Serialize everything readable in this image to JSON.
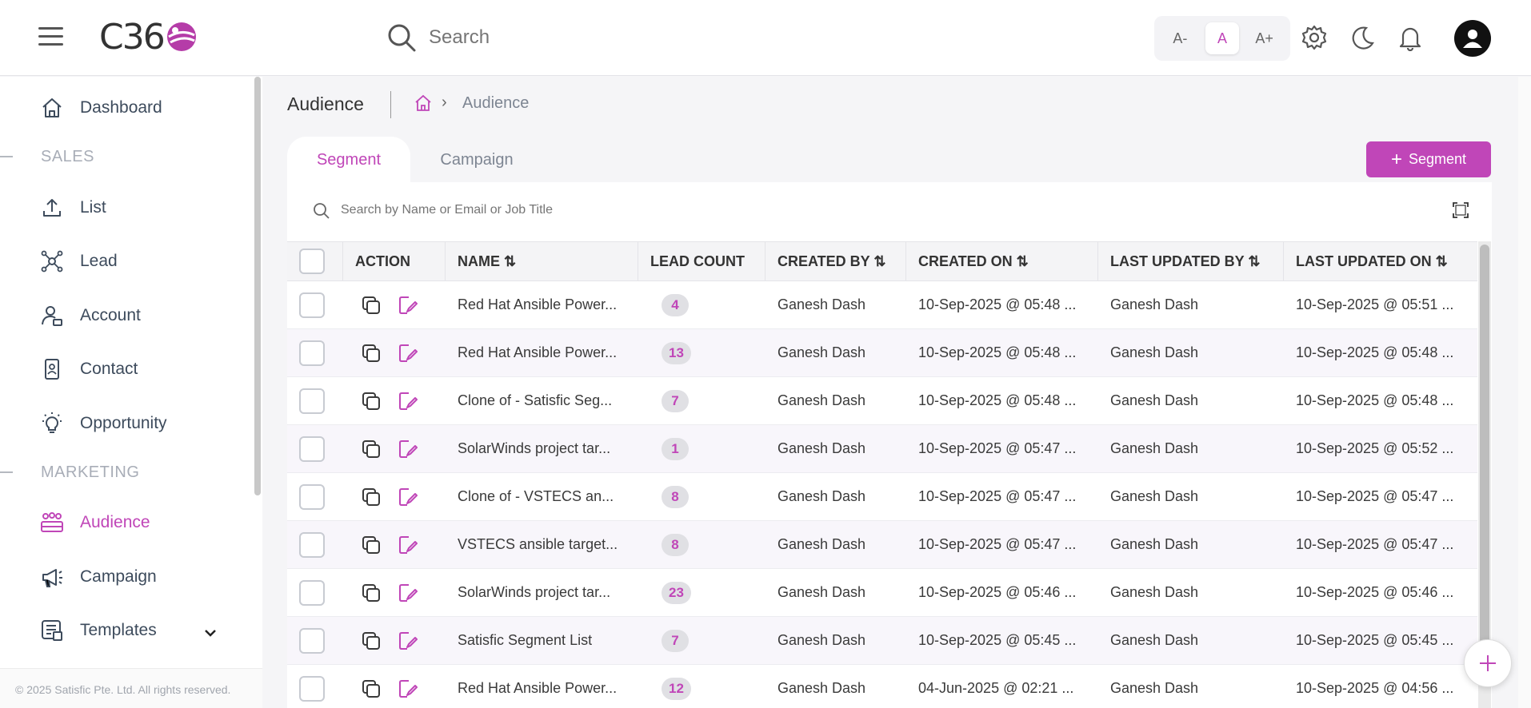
{
  "header": {
    "logo_text": "C36",
    "search_placeholder": "Search",
    "font_small": "A-",
    "font_normal": "A",
    "font_large": "A+"
  },
  "sidebar": {
    "items": [
      {
        "label": "Dashboard",
        "icon": "home-icon"
      },
      {
        "label": "List",
        "icon": "upload-icon"
      },
      {
        "label": "Lead",
        "icon": "network-icon"
      },
      {
        "label": "Account",
        "icon": "user-badge-icon"
      },
      {
        "label": "Contact",
        "icon": "contact-card-icon"
      },
      {
        "label": "Opportunity",
        "icon": "lightbulb-icon"
      },
      {
        "label": "Audience",
        "icon": "group-icon"
      },
      {
        "label": "Campaign",
        "icon": "megaphone-icon"
      },
      {
        "label": "Templates",
        "icon": "template-icon"
      }
    ],
    "sections": [
      "SALES",
      "MARKETING"
    ],
    "footer": "© 2025 Satisfic Pte. Ltd. All rights reserved."
  },
  "page": {
    "title": "Audience",
    "breadcrumb": "Audience",
    "tabs": [
      "Segment",
      "Campaign"
    ],
    "add_button": "Segment",
    "table_search_placeholder": "Search by Name or Email or Job Title"
  },
  "table": {
    "columns": [
      "ACTION",
      "NAME ⇅",
      "LEAD COUNT",
      "CREATED BY ⇅",
      "CREATED ON ⇅",
      "LAST UPDATED BY ⇅",
      "LAST UPDATED ON ⇅"
    ],
    "rows": [
      {
        "name": "Red Hat Ansible Power...",
        "count": "4",
        "created_by": "Ganesh Dash",
        "created_on": "10-Sep-2025 @ 05:48 ...",
        "updated_by": "Ganesh Dash",
        "updated_on": "10-Sep-2025 @ 05:51 ..."
      },
      {
        "name": "Red Hat Ansible Power...",
        "count": "13",
        "created_by": "Ganesh Dash",
        "created_on": "10-Sep-2025 @ 05:48 ...",
        "updated_by": "Ganesh Dash",
        "updated_on": "10-Sep-2025 @ 05:48 ..."
      },
      {
        "name": "Clone of - Satisfic Seg...",
        "count": "7",
        "created_by": "Ganesh Dash",
        "created_on": "10-Sep-2025 @ 05:48 ...",
        "updated_by": "Ganesh Dash",
        "updated_on": "10-Sep-2025 @ 05:48 ..."
      },
      {
        "name": "SolarWinds project tar...",
        "count": "1",
        "created_by": "Ganesh Dash",
        "created_on": "10-Sep-2025 @ 05:47 ...",
        "updated_by": "Ganesh Dash",
        "updated_on": "10-Sep-2025 @ 05:52 ..."
      },
      {
        "name": "Clone of - VSTECS an...",
        "count": "8",
        "created_by": "Ganesh Dash",
        "created_on": "10-Sep-2025 @ 05:47 ...",
        "updated_by": "Ganesh Dash",
        "updated_on": "10-Sep-2025 @ 05:47 ..."
      },
      {
        "name": "VSTECS ansible target...",
        "count": "8",
        "created_by": "Ganesh Dash",
        "created_on": "10-Sep-2025 @ 05:47 ...",
        "updated_by": "Ganesh Dash",
        "updated_on": "10-Sep-2025 @ 05:47 ..."
      },
      {
        "name": "SolarWinds project tar...",
        "count": "23",
        "created_by": "Ganesh Dash",
        "created_on": "10-Sep-2025 @ 05:46 ...",
        "updated_by": "Ganesh Dash",
        "updated_on": "10-Sep-2025 @ 05:46 ..."
      },
      {
        "name": "Satisfic Segment List",
        "count": "7",
        "created_by": "Ganesh Dash",
        "created_on": "10-Sep-2025 @ 05:45 ...",
        "updated_by": "Ganesh Dash",
        "updated_on": "10-Sep-2025 @ 05:45 ..."
      },
      {
        "name": "Red Hat Ansible Power...",
        "count": "12",
        "created_by": "Ganesh Dash",
        "created_on": "04-Jun-2025 @ 02:21 ...",
        "updated_by": "Ganesh Dash",
        "updated_on": "10-Sep-2025 @ 04:56 ..."
      }
    ]
  },
  "colors": {
    "accent": "#c046b8",
    "text": "#3d4b5c"
  }
}
